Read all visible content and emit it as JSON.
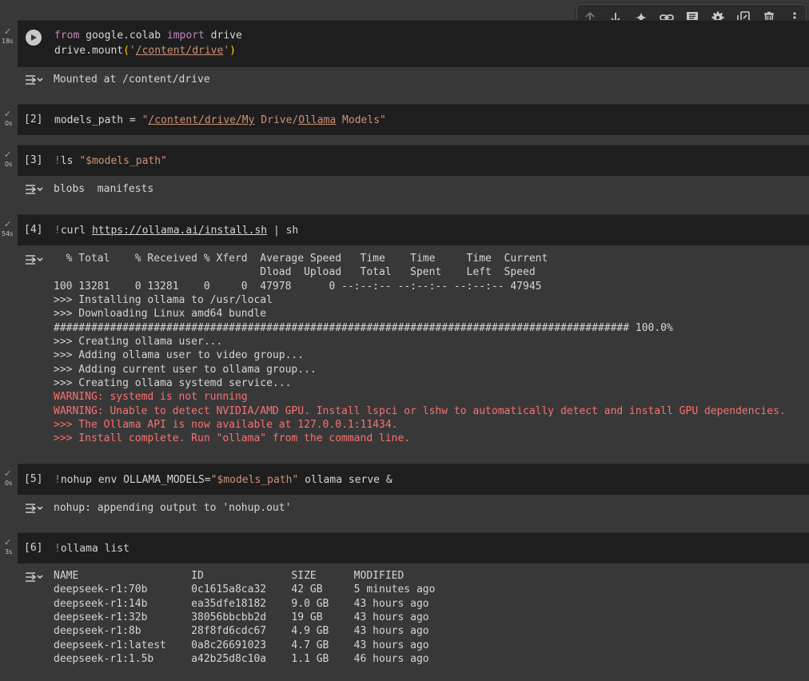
{
  "toolbar": {
    "icons": [
      "arrow-up-icon",
      "arrow-down-icon",
      "sparkle-icon",
      "link-icon",
      "comment-icon",
      "gear-icon",
      "mirror-cell-icon",
      "trash-icon",
      "more-vert-icon"
    ]
  },
  "cells": [
    {
      "time": "18s",
      "number": "",
      "code_lines": [
        "from google.colab import drive",
        "drive.mount('/content/drive')"
      ],
      "output_lines": [
        "Mounted at /content/drive"
      ]
    },
    {
      "time": "0s",
      "number": "[2]",
      "code_lines": [
        "models_path = \"/content/drive/My Drive/Ollama Models\""
      ],
      "output_lines": []
    },
    {
      "time": "0s",
      "number": "[3]",
      "code_lines": [
        "!ls \"$models_path\""
      ],
      "output_lines": [
        "blobs  manifests"
      ]
    },
    {
      "time": "54s",
      "number": "[4]",
      "code_lines": [
        "!curl https://ollama.ai/install.sh | sh"
      ],
      "output_lines": [
        "  % Total    % Received % Xferd  Average Speed   Time    Time     Time  Current",
        "                                 Dload  Upload   Total   Spent    Left  Speed",
        "100 13281    0 13281    0     0  47978      0 --:--:-- --:--:-- --:--:-- 47945",
        ">>> Installing ollama to /usr/local",
        ">>> Downloading Linux amd64 bundle",
        "############################################################################################ 100.0%",
        ">>> Creating ollama user...",
        ">>> Adding ollama user to video group...",
        ">>> Adding current user to ollama group...",
        ">>> Creating ollama systemd service..."
      ],
      "warning_lines": [
        "WARNING: systemd is not running",
        "WARNING: Unable to detect NVIDIA/AMD GPU. Install lspci or lshw to automatically detect and install GPU dependencies.",
        ">>> The Ollama API is now available at 127.0.0.1:11434.",
        ">>> Install complete. Run \"ollama\" from the command line."
      ]
    },
    {
      "time": "0s",
      "number": "[5]",
      "code_lines": [
        "!nohup env OLLAMA_MODELS=\"$models_path\" ollama serve &"
      ],
      "output_lines": [
        "nohup: appending output to 'nohup.out'"
      ]
    },
    {
      "time": "3s",
      "number": "[6]",
      "code_lines": [
        "!ollama list"
      ],
      "output_lines": [
        "NAME                  ID              SIZE      MODIFIED",
        "deepseek-r1:70b       0c1615a8ca32    42 GB     5 minutes ago",
        "deepseek-r1:14b       ea35dfe18182    9.0 GB    43 hours ago",
        "deepseek-r1:32b       38056bbcbb2d    19 GB     43 hours ago",
        "deepseek-r1:8b        28f8fd6cdc67    4.9 GB    43 hours ago",
        "deepseek-r1:latest    0a8c26691023    4.7 GB    43 hours ago",
        "deepseek-r1:1.5b      a42b25d8c10a    1.1 GB    46 hours ago"
      ]
    }
  ]
}
